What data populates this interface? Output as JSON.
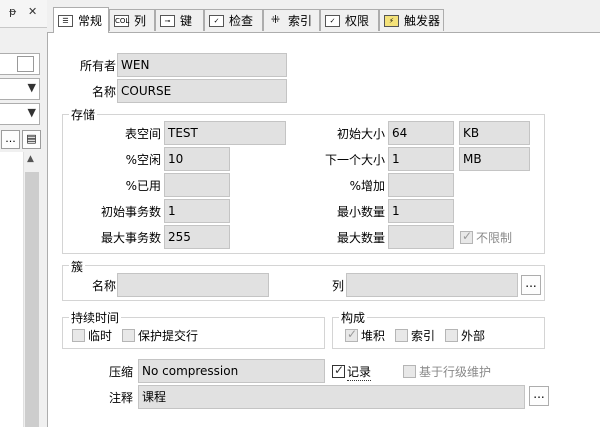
{
  "left_panel": {
    "pin": "ᵽ",
    "close": "✕",
    "btn_more": "...",
    "btn_doc": "▤"
  },
  "tabs": [
    {
      "label": "常规",
      "icon": "general-icon"
    },
    {
      "label": "列",
      "icon": "column-icon"
    },
    {
      "label": "键",
      "icon": "key-icon"
    },
    {
      "label": "检查",
      "icon": "check-icon"
    },
    {
      "label": "索引",
      "icon": "index-icon"
    },
    {
      "label": "权限",
      "icon": "permission-icon"
    },
    {
      "label": "触发器",
      "icon": "trigger-icon"
    }
  ],
  "owner": {
    "label": "所有者",
    "value": "WEN"
  },
  "name": {
    "label": "名称",
    "value": "COURSE"
  },
  "storage": {
    "title": "存储",
    "tablespace": {
      "label": "表空间",
      "value": "TEST"
    },
    "pct_free": {
      "label": "%空闲",
      "value": "10"
    },
    "pct_used": {
      "label": "%已用",
      "value": ""
    },
    "ini_trans": {
      "label": "初始事务数",
      "value": "1"
    },
    "max_trans": {
      "label": "最大事务数",
      "value": "255"
    },
    "initial": {
      "label": "初始大小",
      "value": "64",
      "unit": "KB"
    },
    "next": {
      "label": "下一个大小",
      "value": "1",
      "unit": "MB"
    },
    "pct_increase": {
      "label": "%增加",
      "value": ""
    },
    "min_extents": {
      "label": "最小数量",
      "value": "1"
    },
    "max_extents": {
      "label": "最大数量",
      "value": ""
    },
    "unlimited": {
      "label": "不限制",
      "checked": true
    }
  },
  "cluster": {
    "title": "簇",
    "name_label": "名称",
    "name_value": "",
    "column_label": "列",
    "column_value": "",
    "ellipsis": "..."
  },
  "duration": {
    "title": "持续时间",
    "temporary": {
      "label": "临时",
      "checked": false
    },
    "preserve": {
      "label": "保护提交行",
      "checked": false
    }
  },
  "organization": {
    "title": "构成",
    "heap": {
      "label": "堆积",
      "checked": true
    },
    "index": {
      "label": "索引",
      "checked": false
    },
    "external": {
      "label": "外部",
      "checked": false
    }
  },
  "compress": {
    "label": "压缩",
    "value": "No compression"
  },
  "logging": {
    "label": "记录",
    "checked": true
  },
  "row_level": {
    "label": "基于行级维护",
    "checked": false
  },
  "comment": {
    "label": "注释",
    "value": "课程",
    "ellipsis": "..."
  }
}
